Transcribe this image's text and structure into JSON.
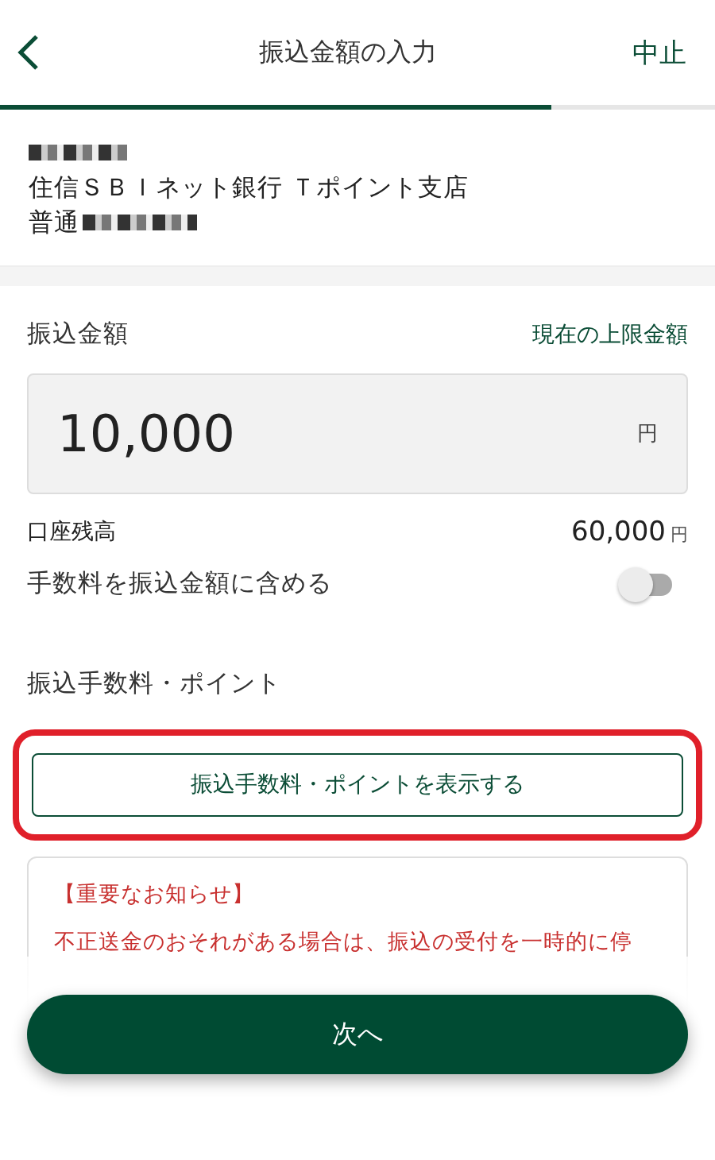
{
  "header": {
    "title": "振込金額の入力",
    "cancel": "中止",
    "progress": {
      "level": 0.77
    }
  },
  "recipient": {
    "bank": "住信ＳＢＩネット銀行 Ｔポイント支店",
    "account_type": "普通"
  },
  "amount": {
    "label": "振込金額",
    "limit_link": "現在の上限金額",
    "value": "10,000",
    "unit": "円"
  },
  "balance": {
    "label": "口座残高",
    "value": "60,000",
    "unit": "円"
  },
  "include_fee": {
    "label": "手数料を振込金額に含める",
    "on": false
  },
  "fee": {
    "label": "振込手数料・ポイント",
    "button": "振込手数料・ポイントを表示する",
    "highlighted": true
  },
  "notice": {
    "title": "【重要なお知らせ】",
    "lines": [
      "不正送金のおそれがある場合は、振込の受付を一時的に停"
    ]
  },
  "next_button": "次へ"
}
